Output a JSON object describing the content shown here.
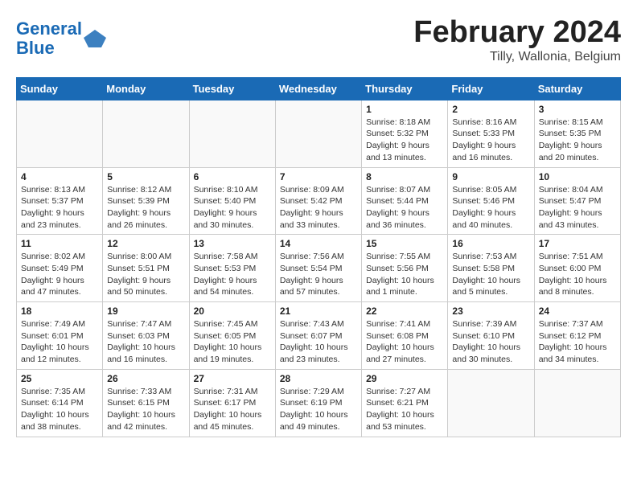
{
  "header": {
    "logo_line1": "General",
    "logo_line2": "Blue",
    "title": "February 2024",
    "subtitle": "Tilly, Wallonia, Belgium"
  },
  "days_of_week": [
    "Sunday",
    "Monday",
    "Tuesday",
    "Wednesday",
    "Thursday",
    "Friday",
    "Saturday"
  ],
  "weeks": [
    [
      {
        "day": "",
        "info": ""
      },
      {
        "day": "",
        "info": ""
      },
      {
        "day": "",
        "info": ""
      },
      {
        "day": "",
        "info": ""
      },
      {
        "day": "1",
        "info": "Sunrise: 8:18 AM\nSunset: 5:32 PM\nDaylight: 9 hours\nand 13 minutes."
      },
      {
        "day": "2",
        "info": "Sunrise: 8:16 AM\nSunset: 5:33 PM\nDaylight: 9 hours\nand 16 minutes."
      },
      {
        "day": "3",
        "info": "Sunrise: 8:15 AM\nSunset: 5:35 PM\nDaylight: 9 hours\nand 20 minutes."
      }
    ],
    [
      {
        "day": "4",
        "info": "Sunrise: 8:13 AM\nSunset: 5:37 PM\nDaylight: 9 hours\nand 23 minutes."
      },
      {
        "day": "5",
        "info": "Sunrise: 8:12 AM\nSunset: 5:39 PM\nDaylight: 9 hours\nand 26 minutes."
      },
      {
        "day": "6",
        "info": "Sunrise: 8:10 AM\nSunset: 5:40 PM\nDaylight: 9 hours\nand 30 minutes."
      },
      {
        "day": "7",
        "info": "Sunrise: 8:09 AM\nSunset: 5:42 PM\nDaylight: 9 hours\nand 33 minutes."
      },
      {
        "day": "8",
        "info": "Sunrise: 8:07 AM\nSunset: 5:44 PM\nDaylight: 9 hours\nand 36 minutes."
      },
      {
        "day": "9",
        "info": "Sunrise: 8:05 AM\nSunset: 5:46 PM\nDaylight: 9 hours\nand 40 minutes."
      },
      {
        "day": "10",
        "info": "Sunrise: 8:04 AM\nSunset: 5:47 PM\nDaylight: 9 hours\nand 43 minutes."
      }
    ],
    [
      {
        "day": "11",
        "info": "Sunrise: 8:02 AM\nSunset: 5:49 PM\nDaylight: 9 hours\nand 47 minutes."
      },
      {
        "day": "12",
        "info": "Sunrise: 8:00 AM\nSunset: 5:51 PM\nDaylight: 9 hours\nand 50 minutes."
      },
      {
        "day": "13",
        "info": "Sunrise: 7:58 AM\nSunset: 5:53 PM\nDaylight: 9 hours\nand 54 minutes."
      },
      {
        "day": "14",
        "info": "Sunrise: 7:56 AM\nSunset: 5:54 PM\nDaylight: 9 hours\nand 57 minutes."
      },
      {
        "day": "15",
        "info": "Sunrise: 7:55 AM\nSunset: 5:56 PM\nDaylight: 10 hours\nand 1 minute."
      },
      {
        "day": "16",
        "info": "Sunrise: 7:53 AM\nSunset: 5:58 PM\nDaylight: 10 hours\nand 5 minutes."
      },
      {
        "day": "17",
        "info": "Sunrise: 7:51 AM\nSunset: 6:00 PM\nDaylight: 10 hours\nand 8 minutes."
      }
    ],
    [
      {
        "day": "18",
        "info": "Sunrise: 7:49 AM\nSunset: 6:01 PM\nDaylight: 10 hours\nand 12 minutes."
      },
      {
        "day": "19",
        "info": "Sunrise: 7:47 AM\nSunset: 6:03 PM\nDaylight: 10 hours\nand 16 minutes."
      },
      {
        "day": "20",
        "info": "Sunrise: 7:45 AM\nSunset: 6:05 PM\nDaylight: 10 hours\nand 19 minutes."
      },
      {
        "day": "21",
        "info": "Sunrise: 7:43 AM\nSunset: 6:07 PM\nDaylight: 10 hours\nand 23 minutes."
      },
      {
        "day": "22",
        "info": "Sunrise: 7:41 AM\nSunset: 6:08 PM\nDaylight: 10 hours\nand 27 minutes."
      },
      {
        "day": "23",
        "info": "Sunrise: 7:39 AM\nSunset: 6:10 PM\nDaylight: 10 hours\nand 30 minutes."
      },
      {
        "day": "24",
        "info": "Sunrise: 7:37 AM\nSunset: 6:12 PM\nDaylight: 10 hours\nand 34 minutes."
      }
    ],
    [
      {
        "day": "25",
        "info": "Sunrise: 7:35 AM\nSunset: 6:14 PM\nDaylight: 10 hours\nand 38 minutes."
      },
      {
        "day": "26",
        "info": "Sunrise: 7:33 AM\nSunset: 6:15 PM\nDaylight: 10 hours\nand 42 minutes."
      },
      {
        "day": "27",
        "info": "Sunrise: 7:31 AM\nSunset: 6:17 PM\nDaylight: 10 hours\nand 45 minutes."
      },
      {
        "day": "28",
        "info": "Sunrise: 7:29 AM\nSunset: 6:19 PM\nDaylight: 10 hours\nand 49 minutes."
      },
      {
        "day": "29",
        "info": "Sunrise: 7:27 AM\nSunset: 6:21 PM\nDaylight: 10 hours\nand 53 minutes."
      },
      {
        "day": "",
        "info": ""
      },
      {
        "day": "",
        "info": ""
      }
    ]
  ]
}
